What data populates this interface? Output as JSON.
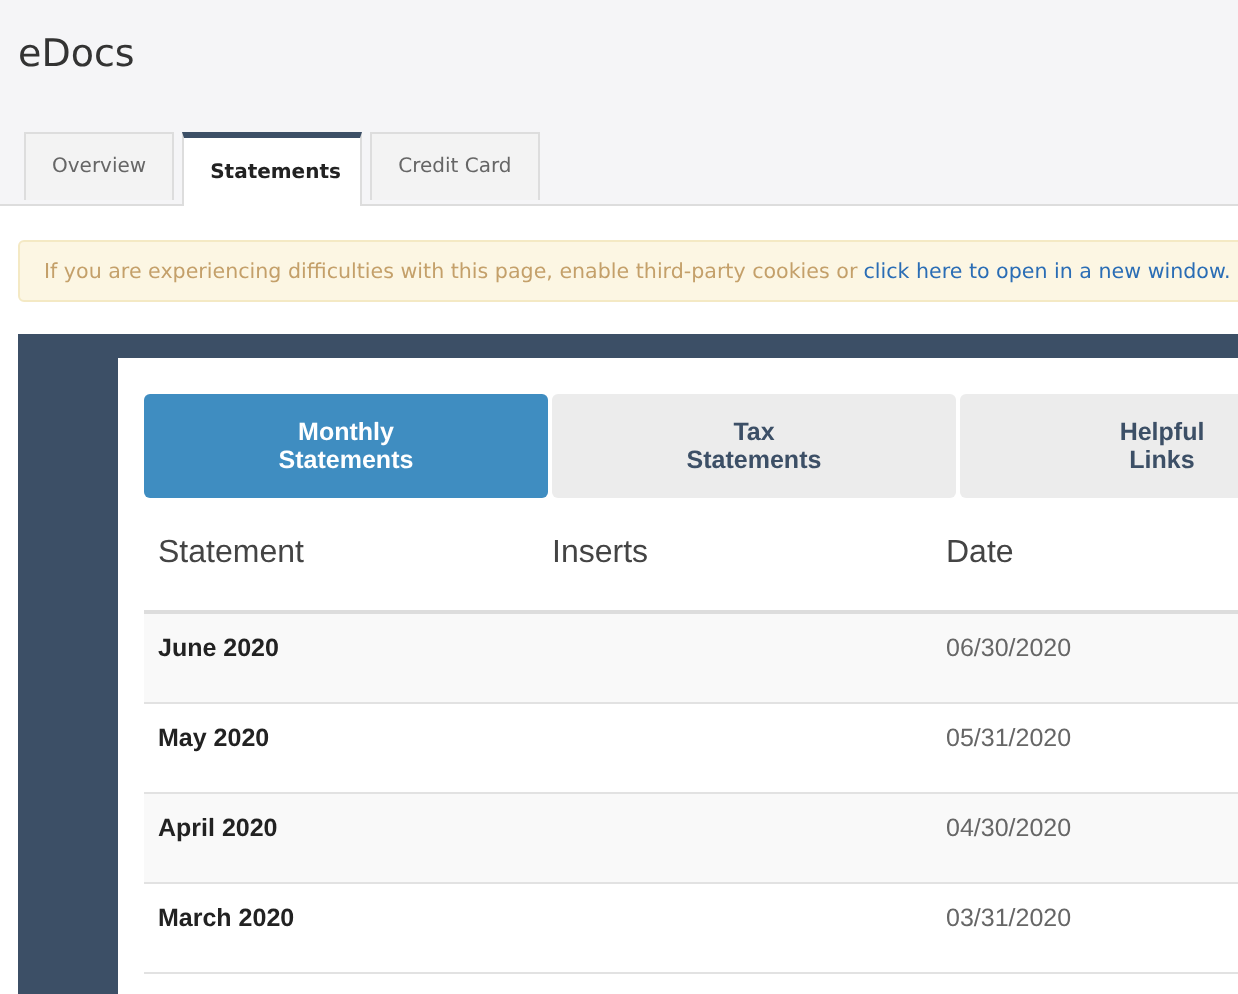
{
  "title": "eDocs",
  "tabs": [
    {
      "label": "Overview",
      "selected": false
    },
    {
      "label": "Statements",
      "selected": true
    },
    {
      "label": "Credit Card",
      "selected": false
    }
  ],
  "alert": {
    "text": "If you are experiencing difficulties with this page, enable third-party cookies or",
    "link": "click here to open in a new window."
  },
  "statement_tabs": [
    {
      "label": "Monthly Statements",
      "selected": true
    },
    {
      "label": "Tax Statements",
      "selected": false
    },
    {
      "label": "Helpful Links",
      "selected": false
    }
  ],
  "table": {
    "columns": [
      "Statement",
      "Inserts",
      "Date"
    ],
    "rows": [
      {
        "statement": "June 2020",
        "date": "06/30/2020"
      },
      {
        "statement": "May 2020",
        "date": "05/31/2020"
      },
      {
        "statement": "April 2020",
        "date": "04/30/2020"
      },
      {
        "statement": "March 2020",
        "date": "03/31/2020"
      }
    ]
  }
}
